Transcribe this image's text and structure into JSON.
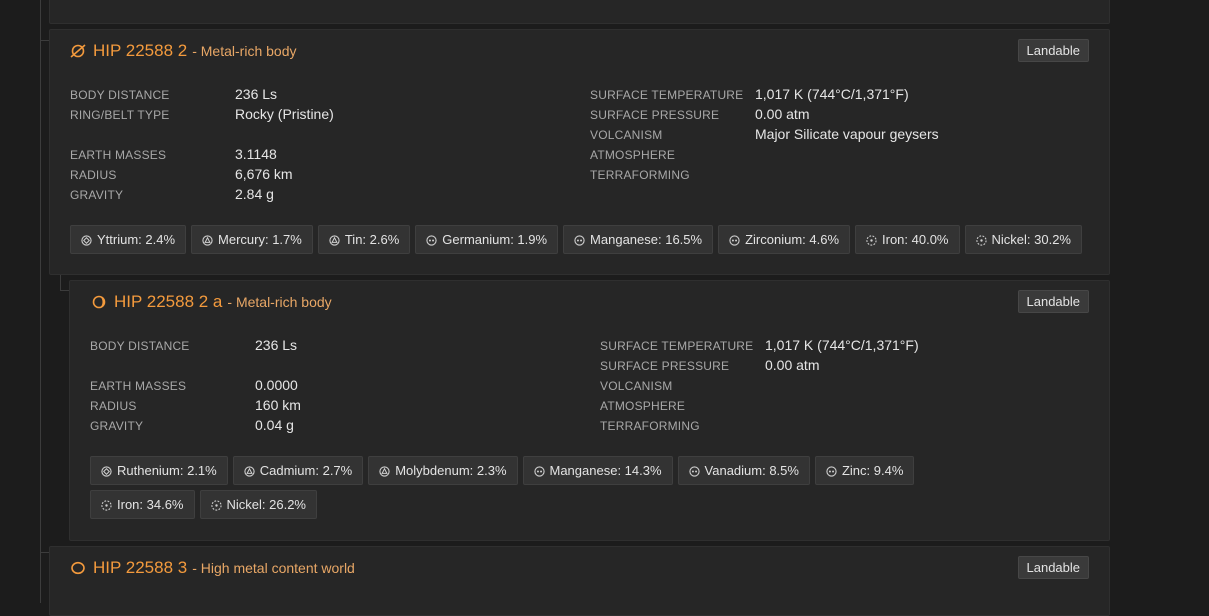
{
  "colors": {
    "accent": "#f39a3d",
    "type_text": "#e8a766"
  },
  "bodies": [
    {
      "name": "HIP 22588 2",
      "type": "- Metal-rich body",
      "icon": "ring-planet-icon",
      "badge": "Landable",
      "left": [
        {
          "label": "BODY DISTANCE",
          "value": "236 Ls"
        },
        {
          "label": "RING/BELT TYPE",
          "value": "Rocky (Pristine)"
        },
        {
          "label": "EARTH MASSES",
          "value": "3.1148"
        },
        {
          "label": "RADIUS",
          "value": "6,676 km"
        },
        {
          "label": "GRAVITY",
          "value": "2.84 g"
        }
      ],
      "right": [
        {
          "label": "SURFACE TEMPERATURE",
          "value": "1,017 K (744°C/1,371°F)"
        },
        {
          "label": "SURFACE PRESSURE",
          "value": "0.00 atm"
        },
        {
          "label": "VOLCANISM",
          "value": "Major Silicate vapour geysers"
        },
        {
          "label": "ATMOSPHERE",
          "value": ""
        },
        {
          "label": "TERRAFORMING",
          "value": ""
        }
      ],
      "materials": [
        {
          "text": "Yttrium: 2.4%",
          "icon": "grade-4-icon"
        },
        {
          "text": "Mercury: 1.7%",
          "icon": "grade-3-icon"
        },
        {
          "text": "Tin: 2.6%",
          "icon": "grade-3-icon"
        },
        {
          "text": "Germanium: 1.9%",
          "icon": "grade-2-icon"
        },
        {
          "text": "Manganese: 16.5%",
          "icon": "grade-2-icon"
        },
        {
          "text": "Zirconium: 4.6%",
          "icon": "grade-2-icon"
        },
        {
          "text": "Iron: 40.0%",
          "icon": "grade-1-icon"
        },
        {
          "text": "Nickel: 30.2%",
          "icon": "grade-1-icon"
        }
      ]
    },
    {
      "name": "HIP 22588 2 a",
      "type": "- Metal-rich body",
      "icon": "moon-icon",
      "badge": "Landable",
      "left": [
        {
          "label": "BODY DISTANCE",
          "value": "236 Ls"
        },
        {
          "label": "EARTH MASSES",
          "value": "0.0000"
        },
        {
          "label": "RADIUS",
          "value": "160 km"
        },
        {
          "label": "GRAVITY",
          "value": "0.04 g"
        }
      ],
      "right": [
        {
          "label": "SURFACE TEMPERATURE",
          "value": "1,017 K (744°C/1,371°F)"
        },
        {
          "label": "SURFACE PRESSURE",
          "value": "0.00 atm"
        },
        {
          "label": "VOLCANISM",
          "value": ""
        },
        {
          "label": "ATMOSPHERE",
          "value": ""
        },
        {
          "label": "TERRAFORMING",
          "value": ""
        }
      ],
      "materials": [
        {
          "text": "Ruthenium: 2.1%",
          "icon": "grade-4-icon"
        },
        {
          "text": "Cadmium: 2.7%",
          "icon": "grade-3-icon"
        },
        {
          "text": "Molybdenum: 2.3%",
          "icon": "grade-3-icon"
        },
        {
          "text": "Manganese: 14.3%",
          "icon": "grade-2-icon"
        },
        {
          "text": "Vanadium: 8.5%",
          "icon": "grade-2-icon"
        },
        {
          "text": "Zinc: 9.4%",
          "icon": "grade-2-icon"
        },
        {
          "text": "Iron: 34.6%",
          "icon": "grade-1-icon"
        },
        {
          "text": "Nickel: 26.2%",
          "icon": "grade-1-icon"
        }
      ]
    },
    {
      "name": "HIP 22588 3",
      "type": "- High metal content world",
      "icon": "planet-icon",
      "badge": "Landable"
    }
  ]
}
